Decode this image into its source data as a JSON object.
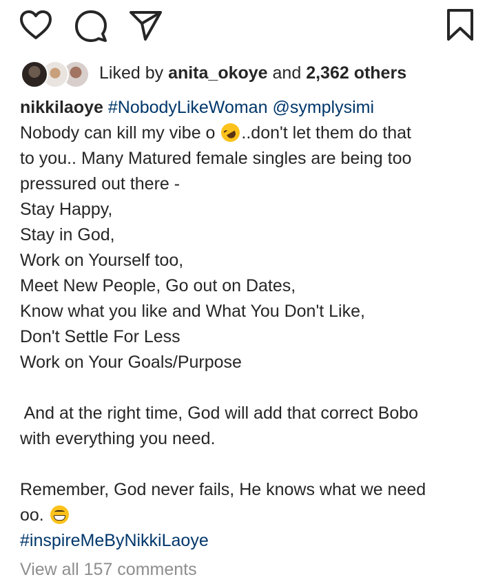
{
  "actions": {
    "like_icon": "heart-icon",
    "comment_icon": "comment-bubble-icon",
    "share_icon": "paper-plane-icon",
    "save_icon": "bookmark-icon"
  },
  "likes": {
    "prefix": "Liked by ",
    "user": "anita_okoye",
    "middle": " and ",
    "count": "2,362 others"
  },
  "caption": {
    "username": "nikkilaoye",
    "hashtag_main": "#NobodyLikeWoman",
    "mention": "@symplysimi",
    "line1_start": "Nobody can kill my vibe o ",
    "line1_emoji": "rolling-on-floor-laughing-emoji",
    "line1_end": "..don't let them do that",
    "line2": "to you.. Many Matured female singles are being too",
    "line3": "pressured out there -",
    "line4": "Stay Happy,",
    "line5": "Stay in God,",
    "line6": "Work on Yourself too,",
    "line7": "Meet New People, Go out on Dates,",
    "line8": "Know what you like and What You Don't Like,",
    "line9": "Don't Settle For Less",
    "line10": "Work on Your Goals/Purpose",
    "line11": " And at the right time, God will add that correct Bobo",
    "line12": "with everything you need.",
    "line13": "Remember, God never fails, He knows what we need",
    "line14_start": "oo. ",
    "line14_emoji": "grinning-face-emoji",
    "hashtag_end": "#inspireMeByNikkiLaoye"
  },
  "comments": {
    "view_all": "View all 157 comments"
  },
  "colors": {
    "text": "#262626",
    "link": "#00376b",
    "muted": "#8e8e8e"
  }
}
